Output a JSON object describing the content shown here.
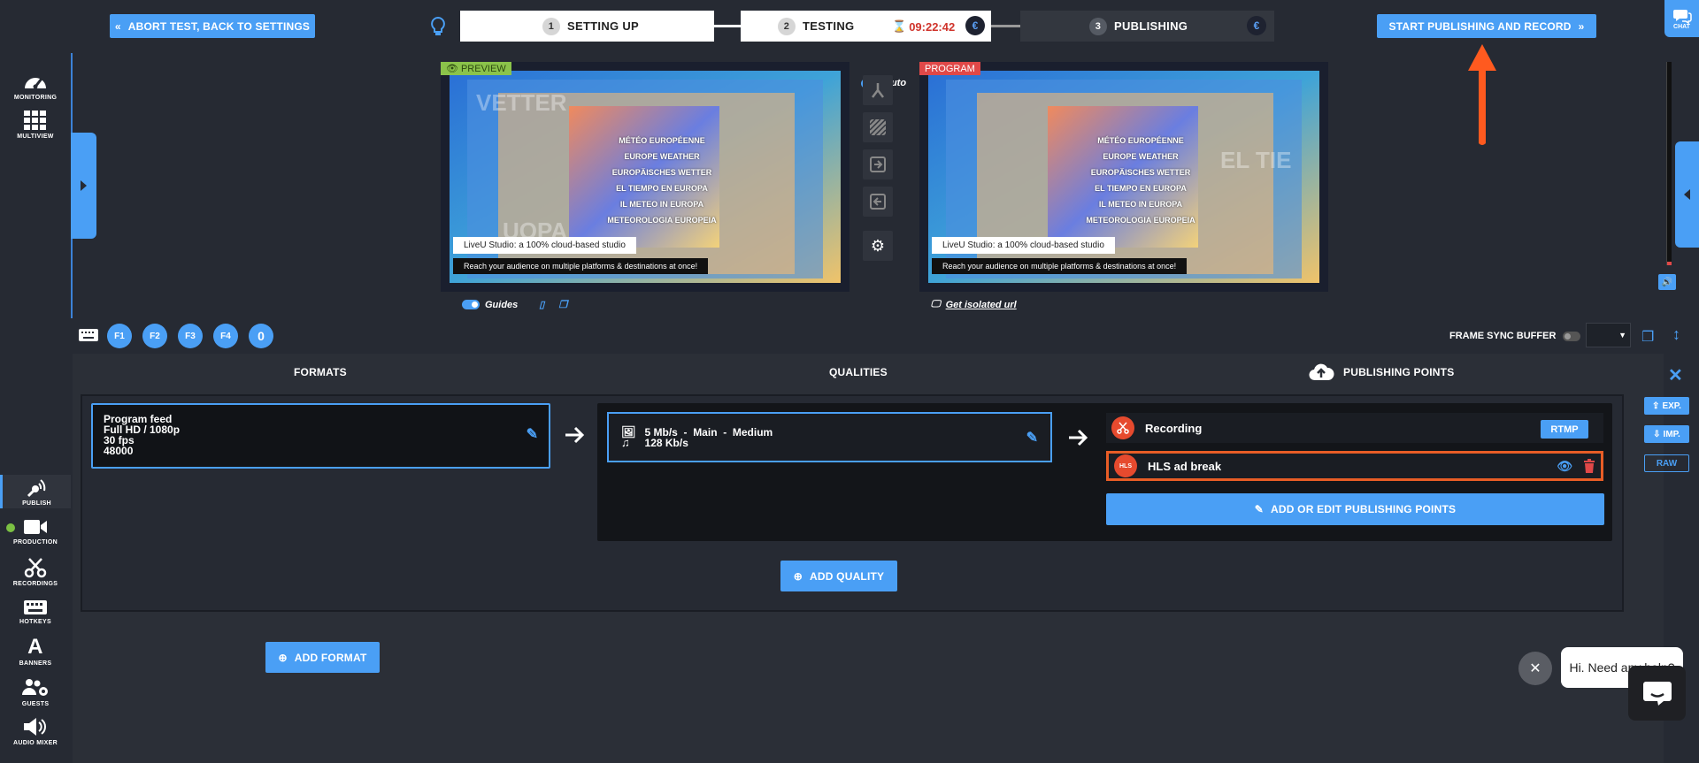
{
  "topbar": {
    "abort_label": "ABORT TEST, BACK TO SETTINGS",
    "start_label": "START PUBLISHING AND RECORD",
    "steps": [
      {
        "num": "1",
        "label": "SETTING UP"
      },
      {
        "num": "2",
        "label": "TESTING"
      },
      {
        "num": "3",
        "label": "PUBLISHING"
      }
    ],
    "timer": "09:22:42",
    "euro": "€",
    "chat_label": "CHAT"
  },
  "nav": {
    "monitoring": "MONITORING",
    "multiview": "MULTIVIEW",
    "publish": "PUBLISH",
    "production": "PRODUCTION",
    "recordings": "RECORDINGS",
    "hotkeys": "HOTKEYS",
    "banners": "BANNERS",
    "guests": "GUESTS",
    "audio_mixer": "AUDIO MIXER"
  },
  "monitors": {
    "preview_tag": "PREVIEW",
    "program_tag": "PROGRAM",
    "auto_label": "Auto",
    "guides_label": "Guides",
    "isolated_url": "Get isolated url",
    "weather_lines": [
      "MÉTÉO EUROPÉENNE",
      "EUROPE WEATHER",
      "EUROPÄISCHES WETTER",
      "EL TIEMPO EN EUROPA",
      "IL METEO IN EUROPA",
      "METEOROLOGIA EUROPEIA"
    ],
    "caption_1": "LiveU Studio: a 100% cloud-based studio",
    "caption_2": "Reach your audience on multiple platforms & destinations at once!"
  },
  "fkeys": [
    "F1",
    "F2",
    "F3",
    "F4",
    "0"
  ],
  "frame_sync": "FRAME SYNC BUFFER",
  "columns": {
    "formats": "FORMATS",
    "qualities": "QUALITIES",
    "publishing_points": "PUBLISHING POINTS"
  },
  "format": {
    "name": "Program feed",
    "resolution": "Full HD / 1080p",
    "fps": "30 fps",
    "audio": "48000"
  },
  "quality": {
    "video": "5 Mb/s  -  Main  -  Medium",
    "audio": "128 Kb/s"
  },
  "publishing_points": {
    "recording_label": "Recording",
    "rtmp_label": "RTMP",
    "hls_badge": "HLS",
    "hls_label": "HLS ad break",
    "add_edit_label": "ADD OR EDIT PUBLISHING POINTS"
  },
  "actions": {
    "add_quality": "ADD QUALITY",
    "add_format": "ADD FORMAT",
    "export": "EXP.",
    "import": "IMP.",
    "raw": "RAW"
  },
  "help": {
    "message": "Hi. Need any help?"
  },
  "colors": {
    "accent": "#4a9ff5",
    "highlight": "#e85d26",
    "timer": "#d0342c"
  }
}
